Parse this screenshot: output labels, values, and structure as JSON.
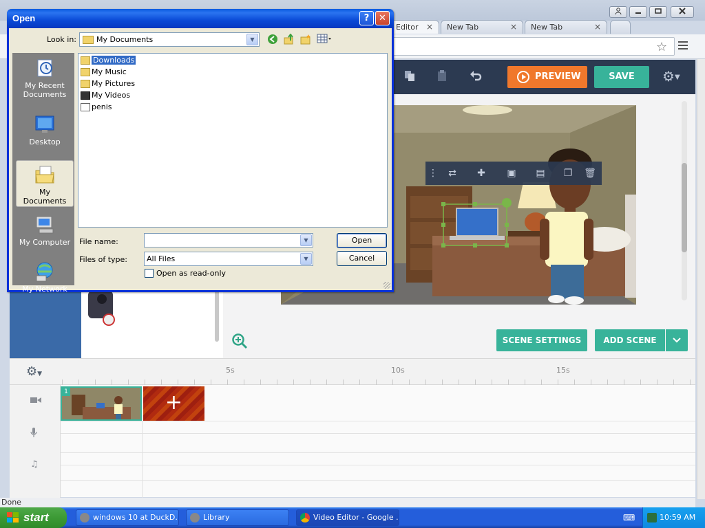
{
  "browser": {
    "tabs": [
      {
        "label": "Editor",
        "close": "×"
      },
      {
        "label": "New Tab",
        "close": "×"
      },
      {
        "label": "New Tab",
        "close": "×"
      }
    ],
    "status": "Done"
  },
  "editor": {
    "topbar": {
      "preview_label": "PREVIEW",
      "save_label": "SAVE"
    },
    "scene_settings_label": "SCENE SETTINGS",
    "add_scene_label": "ADD SCENE",
    "timeline": {
      "ticks": [
        "5s",
        "10s",
        "15s"
      ],
      "scene_number": "1",
      "add_glyph": "+"
    }
  },
  "dialog": {
    "title": "Open",
    "help_glyph": "?",
    "close_glyph": "✕",
    "look_in_label": "Look in:",
    "look_in_value": "My Documents",
    "places": [
      {
        "label": "My Recent Documents",
        "icon": "recent-documents-icon"
      },
      {
        "label": "Desktop",
        "icon": "desktop-icon"
      },
      {
        "label": "My Documents",
        "icon": "my-documents-icon"
      },
      {
        "label": "My Computer",
        "icon": "my-computer-icon"
      },
      {
        "label": "My Network",
        "icon": "my-network-icon"
      }
    ],
    "files": [
      {
        "name": "Downloads",
        "selected": true
      },
      {
        "name": "My Music",
        "selected": false
      },
      {
        "name": "My Pictures",
        "selected": false
      },
      {
        "name": "My Videos",
        "selected": false
      },
      {
        "name": "penis",
        "selected": false
      }
    ],
    "file_name_label": "File name:",
    "file_name_value": "",
    "files_of_type_label": "Files of type:",
    "files_of_type_value": "All Files",
    "read_only_label": "Open as read-only",
    "open_label": "Open",
    "cancel_label": "Cancel"
  },
  "taskbar": {
    "start_label": "start",
    "items": [
      {
        "label": "windows 10 at DuckD..."
      },
      {
        "label": "Library"
      },
      {
        "label": "Video Editor - Google ..."
      }
    ],
    "clock": "10:59 AM"
  },
  "colors": {
    "accent_green": "#38b39a",
    "preview_orange": "#f0782c",
    "topbar_navy": "#2c3a51",
    "xp_blue": "#0a49d6"
  }
}
